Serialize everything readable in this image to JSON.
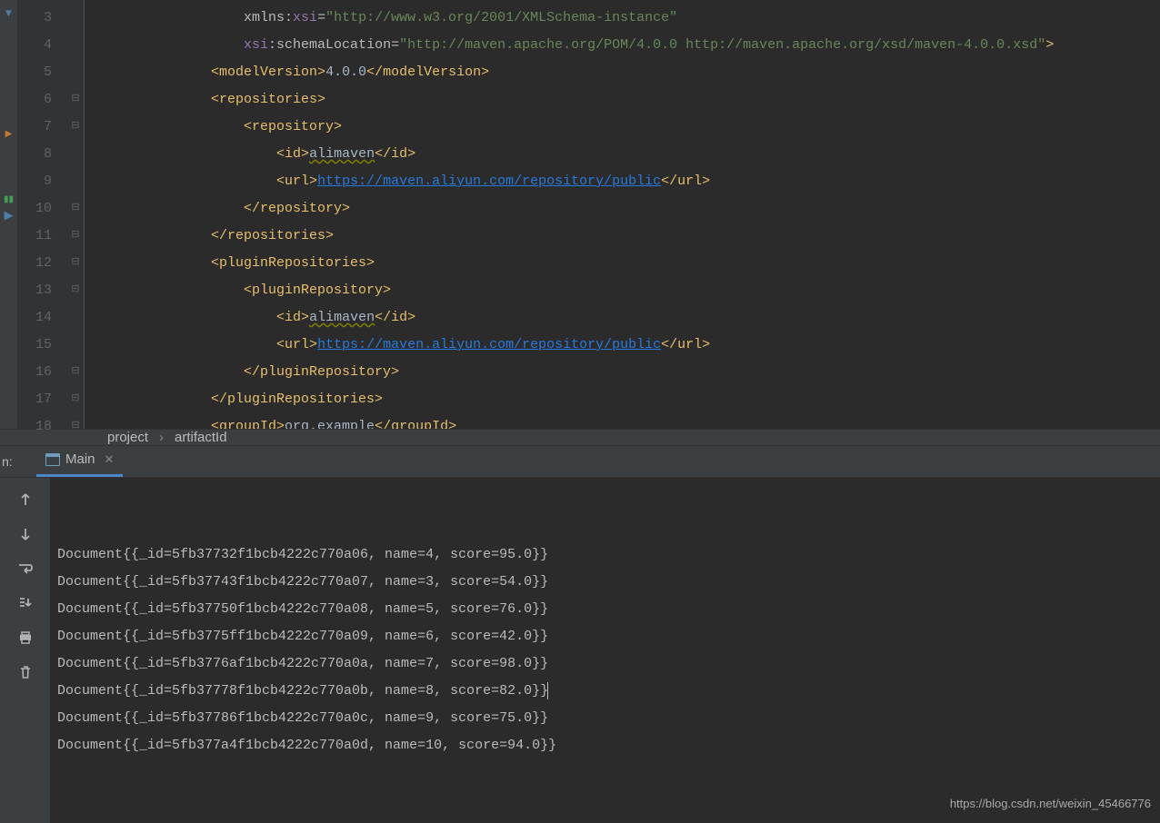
{
  "editor": {
    "startLine": 3,
    "lines": [
      {
        "indent": 19,
        "segments": [
          {
            "t": "attr",
            "v": "xmlns:"
          },
          {
            "t": "attr-ns",
            "v": "xsi"
          },
          {
            "t": "attr",
            "v": "="
          },
          {
            "t": "str",
            "v": "\"http://www.w3.org/2001/XMLSchema-instance\""
          }
        ]
      },
      {
        "indent": 19,
        "segments": [
          {
            "t": "attr-ns",
            "v": "xsi"
          },
          {
            "t": "attr",
            "v": ":schemaLocation="
          },
          {
            "t": "str",
            "v": "\"http://maven.apache.org/POM/4.0.0 http://maven.apache.org/xsd/maven-4.0.0.xsd\""
          },
          {
            "t": "tag",
            "v": ">"
          }
        ]
      },
      {
        "indent": 15,
        "segments": [
          {
            "t": "tag",
            "v": "<modelVersion>"
          },
          {
            "t": "text",
            "v": "4.0.0"
          },
          {
            "t": "tag",
            "v": "</modelVersion>"
          }
        ]
      },
      {
        "indent": 15,
        "segments": [
          {
            "t": "tag",
            "v": "<repositories>"
          }
        ]
      },
      {
        "indent": 19,
        "segments": [
          {
            "t": "tag",
            "v": "<repository>"
          }
        ]
      },
      {
        "indent": 23,
        "segments": [
          {
            "t": "tag",
            "v": "<id>"
          },
          {
            "t": "warn",
            "v": "alimaven"
          },
          {
            "t": "tag",
            "v": "</id>"
          }
        ]
      },
      {
        "indent": 23,
        "segments": [
          {
            "t": "tag",
            "v": "<url>"
          },
          {
            "t": "link",
            "v": "https://maven.aliyun.com/repository/public"
          },
          {
            "t": "tag",
            "v": "</url>"
          }
        ]
      },
      {
        "indent": 19,
        "segments": [
          {
            "t": "tag",
            "v": "</repository>"
          }
        ]
      },
      {
        "indent": 15,
        "segments": [
          {
            "t": "tag",
            "v": "</repositories>"
          }
        ]
      },
      {
        "indent": 15,
        "segments": [
          {
            "t": "tag",
            "v": "<pluginRepositories>"
          }
        ]
      },
      {
        "indent": 19,
        "segments": [
          {
            "t": "tag",
            "v": "<pluginRepository>"
          }
        ]
      },
      {
        "indent": 23,
        "segments": [
          {
            "t": "tag",
            "v": "<id>"
          },
          {
            "t": "warn",
            "v": "alimaven"
          },
          {
            "t": "tag",
            "v": "</id>"
          }
        ]
      },
      {
        "indent": 23,
        "segments": [
          {
            "t": "tag",
            "v": "<url>"
          },
          {
            "t": "link",
            "v": "https://maven.aliyun.com/repository/public"
          },
          {
            "t": "tag",
            "v": "</url>"
          }
        ]
      },
      {
        "indent": 19,
        "segments": [
          {
            "t": "tag",
            "v": "</pluginRepository>"
          }
        ]
      },
      {
        "indent": 15,
        "segments": [
          {
            "t": "tag",
            "v": "</pluginRepositories>"
          }
        ]
      },
      {
        "indent": 15,
        "segments": [
          {
            "t": "tag",
            "v": "<groupId>"
          },
          {
            "t": "text",
            "v": "org.example"
          },
          {
            "t": "tag",
            "v": "</groupId>"
          }
        ]
      }
    ]
  },
  "breadcrumb": {
    "items": [
      "project",
      "artifactId"
    ]
  },
  "runLabel": "n:",
  "consoleTab": {
    "label": "Main"
  },
  "consoleLines": [
    "Document{{_id=5fb37732f1bcb4222c770a06, name=4, score=95.0}}",
    "Document{{_id=5fb37743f1bcb4222c770a07, name=3, score=54.0}}",
    "Document{{_id=5fb37750f1bcb4222c770a08, name=5, score=76.0}}",
    "Document{{_id=5fb3775ff1bcb4222c770a09, name=6, score=42.0}}",
    "Document{{_id=5fb3776af1bcb4222c770a0a, name=7, score=98.0}}",
    "Document{{_id=5fb37778f1bcb4222c770a0b, name=8, score=82.0}}",
    "Document{{_id=5fb37786f1bcb4222c770a0c, name=9, score=75.0}}",
    "Document{{_id=5fb377a4f1bcb4222c770a0d, name=10, score=94.0}}"
  ],
  "watermark": "https://blog.csdn.net/weixin_45466776"
}
